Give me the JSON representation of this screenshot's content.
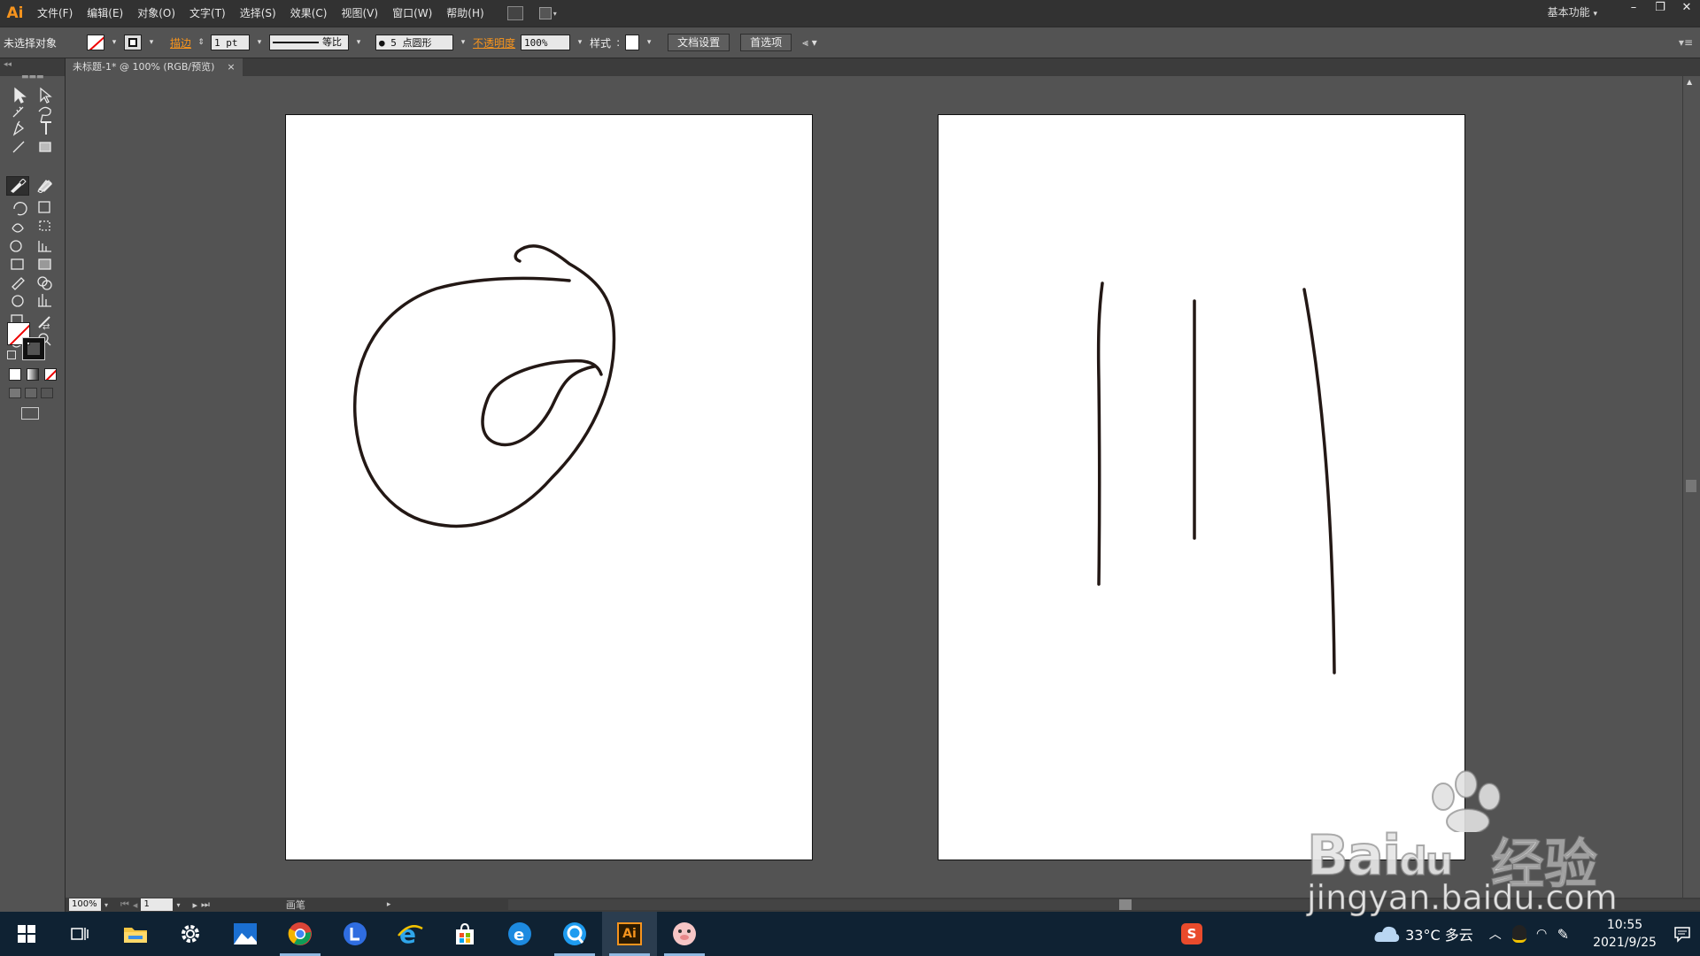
{
  "app": {
    "logo": "Ai",
    "menus": [
      "文件(F)",
      "编辑(E)",
      "对象(O)",
      "文字(T)",
      "选择(S)",
      "效果(C)",
      "视图(V)",
      "窗口(W)",
      "帮助(H)"
    ],
    "workspace": "基本功能"
  },
  "window_controls": {
    "minimize": "–",
    "restore": "❐",
    "close": "✕"
  },
  "controlbar": {
    "selection_status": "未选择对象",
    "stroke_label": "描边",
    "stroke_weight": "1 pt",
    "stroke_profile": "等比",
    "brush": "● 5 点圆形",
    "opacity_label": "不透明度",
    "opacity_value": "100%",
    "style_label": "样式",
    "doc_setup_button": "文档设置",
    "preferences_button": "首选项"
  },
  "document_tab": {
    "title": "未标题-1* @ 100% (RGB/预览)",
    "close": "×"
  },
  "statusbar": {
    "zoom": "100%",
    "artboard_number": "1",
    "current_tool": "画笔"
  },
  "taskbar": {
    "apps": [
      {
        "name": "start",
        "icon": "windows-logo-icon"
      },
      {
        "name": "task-view",
        "icon": "task-view-icon"
      },
      {
        "name": "file-explorer",
        "icon": "folder-icon"
      },
      {
        "name": "settings",
        "icon": "gear-icon"
      },
      {
        "name": "photos",
        "icon": "photos-icon"
      },
      {
        "name": "chrome",
        "icon": "chrome-icon"
      },
      {
        "name": "l-app",
        "icon": "l-letter-icon"
      },
      {
        "name": "internet-explorer",
        "icon": "ie-icon"
      },
      {
        "name": "store",
        "icon": "store-bag-icon"
      },
      {
        "name": "edge-legacy",
        "icon": "edge-icon"
      },
      {
        "name": "browser-q",
        "icon": "q-browser-icon"
      },
      {
        "name": "illustrator",
        "icon": "ai-icon",
        "label": "Ai"
      },
      {
        "name": "face-app",
        "icon": "pig-face-icon"
      }
    ],
    "weather": "33°C 多云",
    "time": "10:55",
    "date": "2021/9/25"
  },
  "watermark": {
    "brand": "Bai",
    "brand_suffix": "du",
    "cn": "经验",
    "url": "jingyan.baidu.com"
  },
  "colors": {
    "accent_orange": "#f7941d",
    "panel_bg": "#535353",
    "menubar_bg": "#323232",
    "taskbar_bg": "#0f2233",
    "stroke_color": "#231815"
  }
}
